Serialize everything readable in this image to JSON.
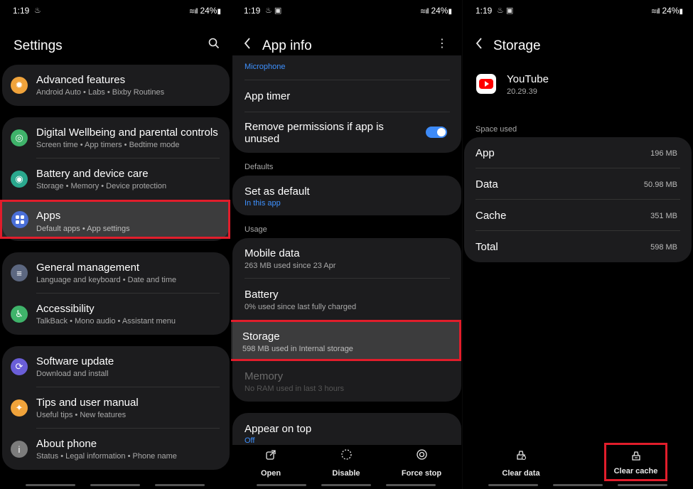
{
  "status": {
    "time": "1:19",
    "battery": "24%"
  },
  "panel1": {
    "title": "Settings",
    "groups": [
      [
        {
          "label": "Advanced features",
          "sub": "Android Auto  •  Labs  •  Bixby Routines",
          "icon": "star-gear-icon",
          "color": "#f0a33b"
        }
      ],
      [
        {
          "label": "Digital Wellbeing and parental controls",
          "sub": "Screen time  •  App timers  •  Bedtime mode",
          "icon": "wellbeing-icon",
          "color": "#3fb36a"
        },
        {
          "label": "Battery and device care",
          "sub": "Storage  •  Memory  •  Device protection",
          "icon": "device-care-icon",
          "color": "#2aa88e"
        },
        {
          "label": "Apps",
          "sub": "Default apps  •  App settings",
          "icon": "apps-grid-icon",
          "color": "#4a6fd8"
        }
      ],
      [
        {
          "label": "General management",
          "sub": "Language and keyboard  •  Date and time",
          "icon": "sliders-icon",
          "color": "#5c6780"
        },
        {
          "label": "Accessibility",
          "sub": "TalkBack  •  Mono audio  •  Assistant menu",
          "icon": "accessibility-icon",
          "color": "#3fb36a"
        }
      ],
      [
        {
          "label": "Software update",
          "sub": "Download and install",
          "icon": "update-icon",
          "color": "#6a5ed8"
        },
        {
          "label": "Tips and user manual",
          "sub": "Useful tips  •  New features",
          "icon": "bulb-icon",
          "color": "#f0a33b"
        },
        {
          "label": "About phone",
          "sub": "Status  •  Legal information  •  Phone name",
          "icon": "info-icon",
          "color": "#7c7c7c"
        }
      ]
    ]
  },
  "panel2": {
    "title": "App info",
    "top_partial": "Microphone",
    "app_timer": "App timer",
    "remove_perm": "Remove permissions if app is unused",
    "defaults_label": "Defaults",
    "set_default": "Set as default",
    "set_default_sub": "In this app",
    "usage_label": "Usage",
    "mobile_data": "Mobile data",
    "mobile_data_sub": "263 MB used since 23 Apr",
    "battery": "Battery",
    "battery_sub": "0% used since last fully charged",
    "storage": "Storage",
    "storage_sub": "598 MB used in Internal storage",
    "memory": "Memory",
    "memory_sub": "No RAM used in last 3 hours",
    "appear_on_top": "Appear on top",
    "appear_on_top_sub": "Off",
    "actions": [
      "Open",
      "Disable",
      "Force stop"
    ]
  },
  "panel3": {
    "title": "Storage",
    "app_name": "YouTube",
    "app_version": "20.29.39",
    "space_used_label": "Space used",
    "rows": [
      {
        "label": "App",
        "value": "196 MB"
      },
      {
        "label": "Data",
        "value": "50.98 MB"
      },
      {
        "label": "Cache",
        "value": "351 MB"
      },
      {
        "label": "Total",
        "value": "598 MB"
      }
    ],
    "actions": [
      "Clear data",
      "Clear cache"
    ]
  }
}
